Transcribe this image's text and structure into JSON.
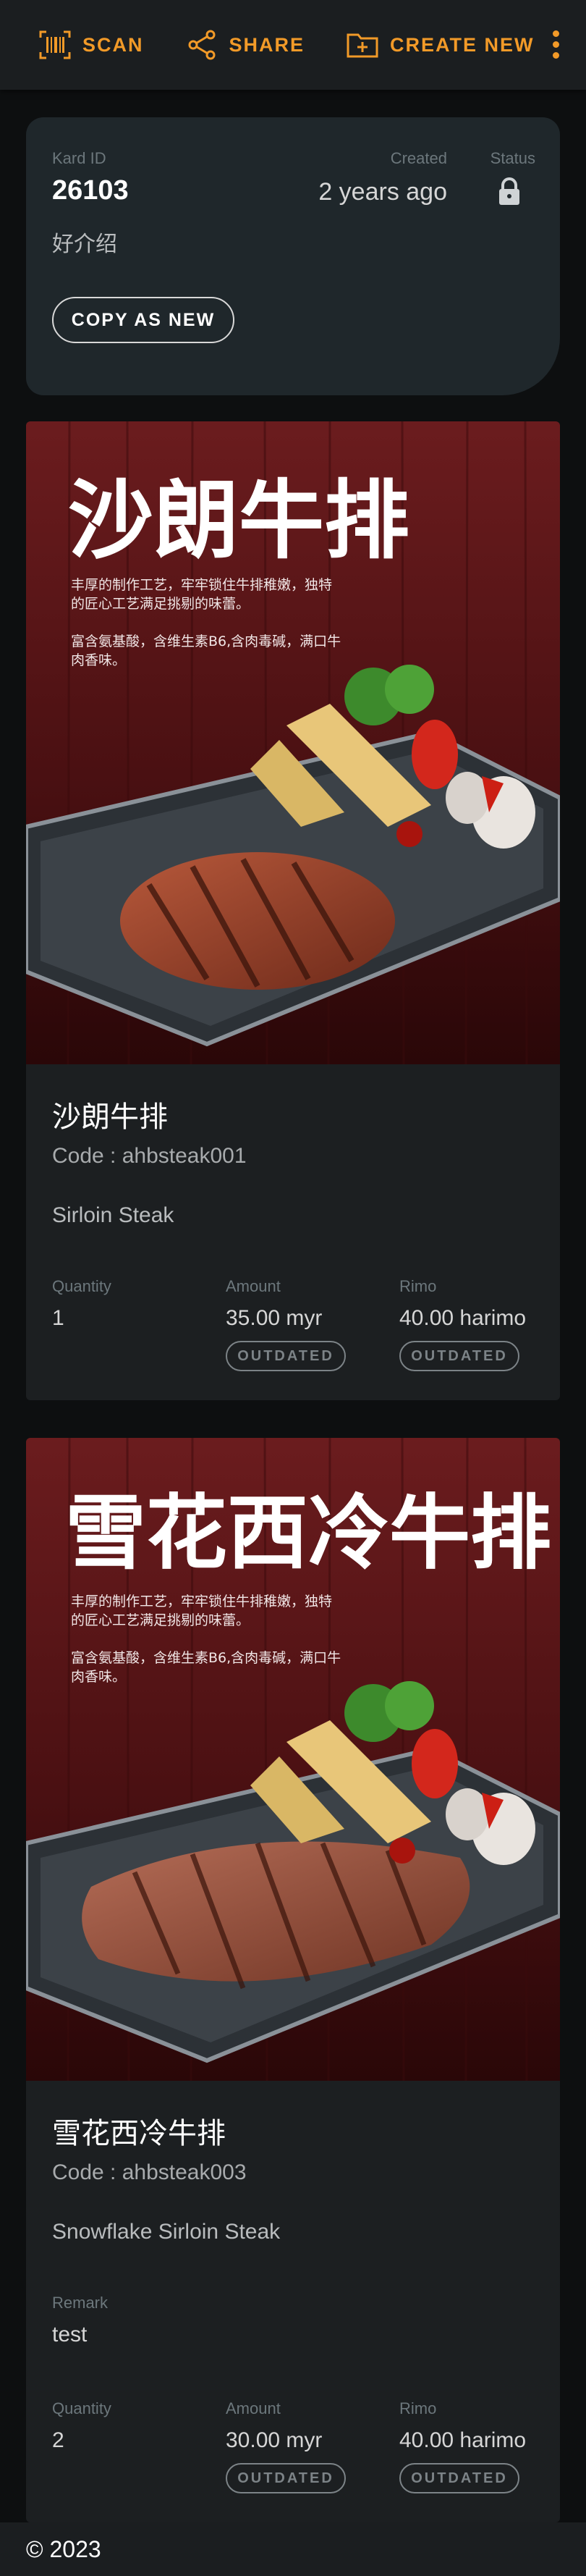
{
  "toolbar": {
    "scan_label": "SCAN",
    "share_label": "SHARE",
    "create_label": "CREATE NEW",
    "accent": "#f29a28"
  },
  "card": {
    "id_label": "Kard ID",
    "id": "26103",
    "created_label": "Created",
    "created": "2 years ago",
    "status_label": "Status",
    "status_icon": "lock-icon",
    "intro": "好介绍",
    "copy_button": "COPY AS NEW"
  },
  "items": [
    {
      "poster_title": "沙朗牛排",
      "poster_line1": "丰厚的制作工艺，牢牢锁住牛排稚嫩，独特",
      "poster_line2": "的匠心工艺满足挑剔的味蕾。",
      "poster_line3": "富含氨基酸，含维生素B6,含肉毒碱，满口牛",
      "poster_line4": "肉香味。",
      "name": "沙朗牛排",
      "code": "Code : ahbsteak001",
      "english_name": "Sirloin Steak",
      "quantity_label": "Quantity",
      "quantity": "1",
      "amount_label": "Amount",
      "amount": "35.00 myr",
      "amount_badge": "OUTDATED",
      "rimo_label": "Rimo",
      "rimo": "40.00 harimo",
      "rimo_badge": "OUTDATED"
    },
    {
      "poster_title": "雪花西冷牛排",
      "poster_line1": "丰厚的制作工艺，牢牢锁住牛排稚嫩，独特",
      "poster_line2": "的匠心工艺满足挑剔的味蕾。",
      "poster_line3": "富含氨基酸，含维生素B6,含肉毒碱，满口牛",
      "poster_line4": "肉香味。",
      "name": "雪花西冷牛排",
      "code": "Code : ahbsteak003",
      "english_name": "Snowflake Sirloin Steak",
      "remark_label": "Remark",
      "remark": "test",
      "quantity_label": "Quantity",
      "quantity": "2",
      "amount_label": "Amount",
      "amount": "30.00 myr",
      "amount_badge": "OUTDATED",
      "rimo_label": "Rimo",
      "rimo": "40.00 harimo",
      "rimo_badge": "OUTDATED"
    }
  ],
  "footer": {
    "copyright": "© 2023"
  }
}
